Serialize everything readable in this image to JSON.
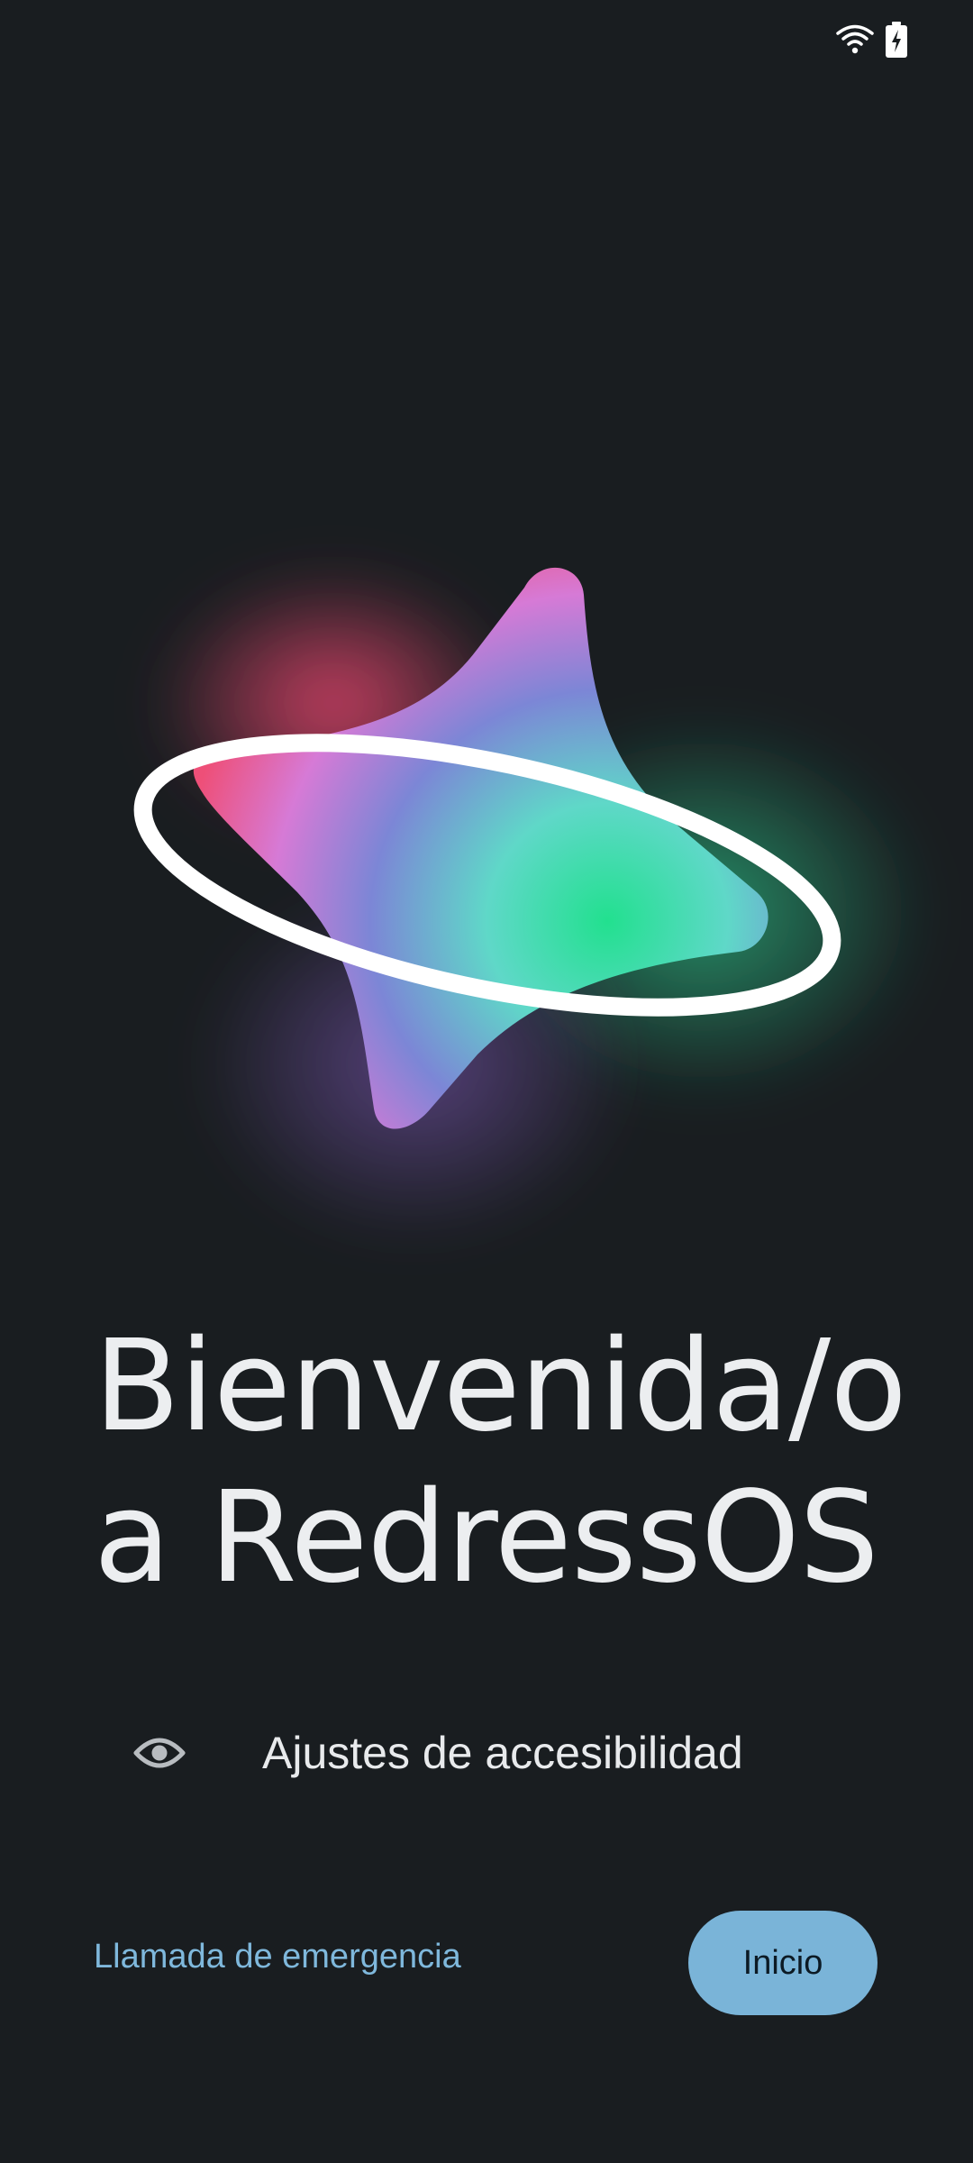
{
  "status_bar": {
    "wifi_icon": "wifi-icon",
    "battery_icon": "battery-charging-icon"
  },
  "hero": {
    "icon": "star-orbit-logo",
    "colors": {
      "pink": "#e8456e",
      "magenta": "#d67ad6",
      "blue": "#7c86d6",
      "teal": "#5fd8c8",
      "green": "#2edf9a",
      "ring": "#ffffff"
    }
  },
  "welcome": {
    "line1": "Bienvenida/o",
    "line2": "a RedressOS"
  },
  "accessibility": {
    "icon": "eye-icon",
    "label": "Ajustes de accesibilidad"
  },
  "footer": {
    "emergency_label": "Llamada de emergencia",
    "start_label": "Inicio"
  },
  "colors": {
    "background": "#191d20",
    "link": "#7fb8dc",
    "button": "#7ab4d8"
  }
}
